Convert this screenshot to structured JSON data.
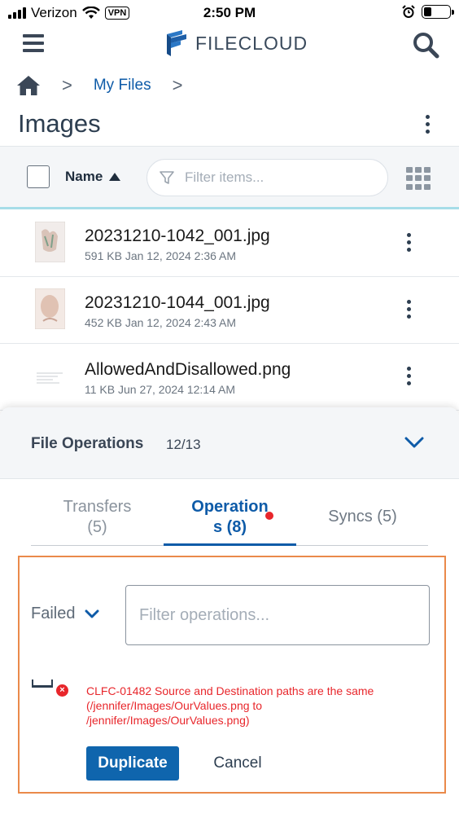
{
  "status_bar": {
    "carrier": "Verizon",
    "vpn": "VPN",
    "time": "2:50 PM"
  },
  "header": {
    "logo_text": "FILECLOUD",
    "icons": [
      "menu-icon",
      "filecloud-logo",
      "search-icon"
    ]
  },
  "breadcrumb": {
    "home_icon": "home-icon",
    "separator": ">",
    "items": [
      "My Files"
    ]
  },
  "page": {
    "title": "Images"
  },
  "toolbar": {
    "sort_label": "Name",
    "sort_direction": "ascending",
    "filter_placeholder": "Filter items...",
    "filter_value": ""
  },
  "files": [
    {
      "name": "20231210-1042_001.jpg",
      "meta": "591 KB Jan 12, 2024 2:36 AM"
    },
    {
      "name": "20231210-1044_001.jpg",
      "meta": "452 KB Jan 12, 2024 2:43 AM"
    },
    {
      "name": "AllowedAndDisallowed.png",
      "meta": "11 KB Jun 27, 2024 12:14 AM"
    }
  ],
  "panel": {
    "title": "File Operations",
    "count": "12/13",
    "tabs": [
      {
        "label": "Transfers (5)",
        "active": false
      },
      {
        "label": "Operations (8)",
        "active": true,
        "has_notification": true
      },
      {
        "label": "Syncs (5)",
        "active": false
      }
    ],
    "status_filter": "Failed",
    "ops_filter_placeholder": "Filter operations...",
    "ops_filter_value": "",
    "error_message": "CLFC-01482  Source and Destination paths are the same (/jennifer/Images/OurValues.png to /jennifer/Images/OurValues.png)",
    "primary_action": "Duplicate",
    "secondary_action": "Cancel"
  },
  "colors": {
    "brand_blue": "#0e5ba8",
    "error_red": "#e8262b",
    "highlight_orange": "#ea8a4a",
    "accent_teal": "#a6dde8"
  }
}
